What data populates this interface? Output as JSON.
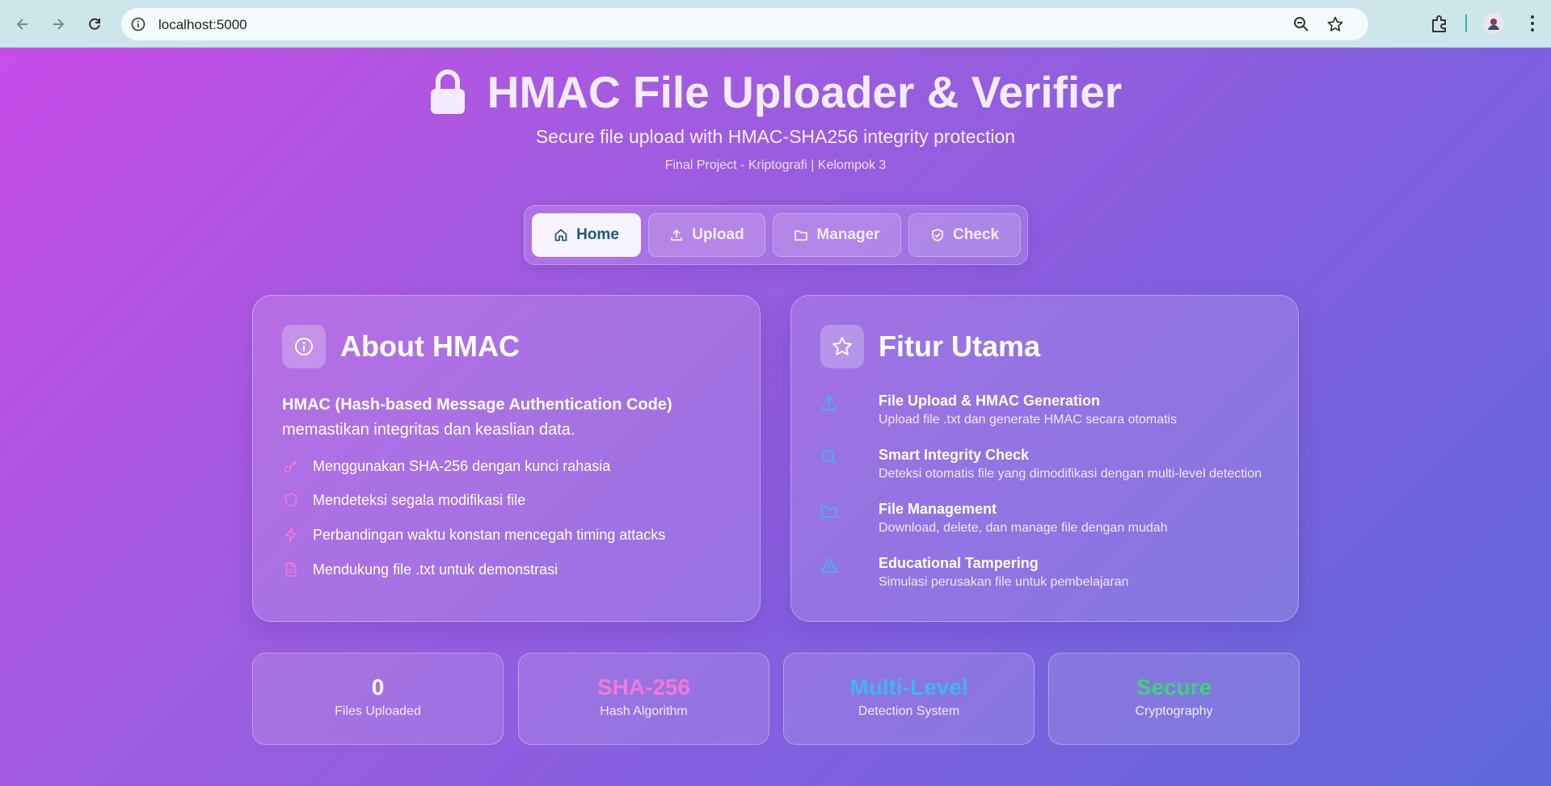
{
  "browser": {
    "url": "localhost:5000"
  },
  "header": {
    "title": "HMAC File Uploader & Verifier",
    "subtitle": "Secure file upload with HMAC-SHA256 integrity protection",
    "project_info": "Final Project - Kriptografi | Kelompok 3"
  },
  "nav": {
    "items": [
      {
        "label": "Home",
        "icon": "home-icon",
        "active": true
      },
      {
        "label": "Upload",
        "icon": "upload-icon",
        "active": false
      },
      {
        "label": "Manager",
        "icon": "folder-icon",
        "active": false
      },
      {
        "label": "Check",
        "icon": "shield-check-icon",
        "active": false
      }
    ]
  },
  "about": {
    "title": "About HMAC",
    "icon": "info-icon",
    "lead_bold": "HMAC (Hash-based Message Authentication Code)",
    "lead_rest": "memastikan integritas dan keaslian data.",
    "items": [
      {
        "icon": "key-icon",
        "text": "Menggunakan SHA-256 dengan kunci rahasia"
      },
      {
        "icon": "shield-icon",
        "text": "Mendeteksi segala modifikasi file"
      },
      {
        "icon": "lightning-icon",
        "text": "Perbandingan waktu konstan mencegah timing attacks"
      },
      {
        "icon": "document-icon",
        "text": "Mendukung file .txt untuk demonstrasi"
      }
    ]
  },
  "features": {
    "title": "Fitur Utama",
    "icon": "star-icon",
    "items": [
      {
        "icon": "upload-icon",
        "title": "File Upload & HMAC Generation",
        "desc": "Upload file .txt dan generate HMAC secara otomatis"
      },
      {
        "icon": "search-icon",
        "title": "Smart Integrity Check",
        "desc": "Deteksi otomatis file yang dimodifikasi dengan multi-level detection"
      },
      {
        "icon": "folder-icon",
        "title": "File Management",
        "desc": "Download, delete, dan manage file dengan mudah"
      },
      {
        "icon": "warning-icon",
        "title": "Educational Tampering",
        "desc": "Simulasi perusakan file untuk pembelajaran"
      }
    ]
  },
  "stats": [
    {
      "value": "0",
      "label": "Files Uploaded",
      "color": "#ffffff"
    },
    {
      "value": "SHA-256",
      "label": "Hash Algorithm",
      "color": "#f07ad6"
    },
    {
      "value": "Multi-Level",
      "label": "Detection System",
      "color": "#3fb6f0"
    },
    {
      "value": "Secure",
      "label": "Cryptography",
      "color": "#3ed27a"
    }
  ],
  "colors": {
    "accent_pink": "#f07ad6",
    "accent_blue": "#3fb6f0",
    "accent_green": "#3ed27a",
    "active_nav_text": "#1e5a78"
  }
}
